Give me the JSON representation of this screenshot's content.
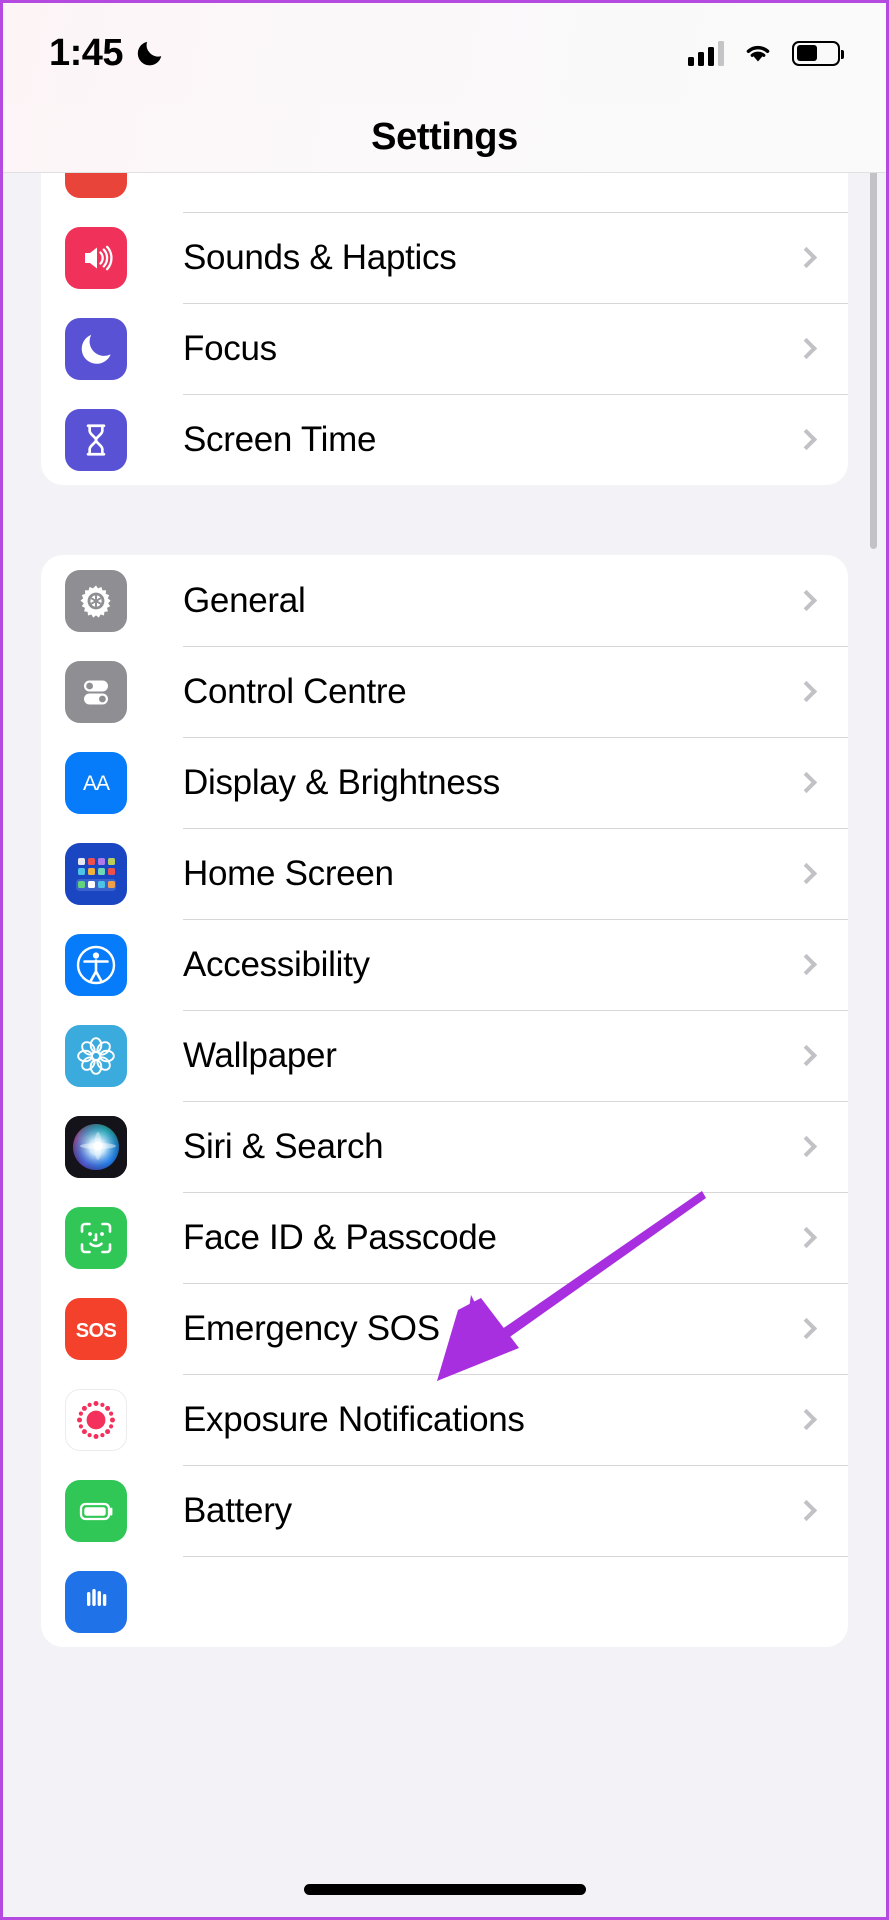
{
  "status_bar": {
    "time": "1:45",
    "dnd_icon": "crescent-moon-icon",
    "cellular_icon": "signal-bars-icon",
    "wifi_icon": "wifi-icon",
    "battery_icon": "battery-icon"
  },
  "nav": {
    "title": "Settings"
  },
  "groups": [
    {
      "id": "group-personal",
      "clipped": true,
      "rows": [
        {
          "label": "",
          "icon": "notifications-icon",
          "icon_color": "#e8443a",
          "partial": true
        },
        {
          "label": "Sounds & Haptics",
          "icon": "speaker-waves-icon",
          "icon_color": "#f0325a"
        },
        {
          "label": "Focus",
          "icon": "moon-icon",
          "icon_color": "#5a52d5"
        },
        {
          "label": "Screen Time",
          "icon": "hourglass-icon",
          "icon_color": "#5a52d5"
        }
      ]
    },
    {
      "id": "group-system",
      "clipped": false,
      "rows": [
        {
          "label": "General",
          "icon": "gear-icon",
          "icon_color": "#8e8e93"
        },
        {
          "label": "Control Centre",
          "icon": "toggles-icon",
          "icon_color": "#8e8e93"
        },
        {
          "label": "Display & Brightness",
          "icon": "aa-text-icon",
          "icon_color": "#067cfa"
        },
        {
          "label": "Home Screen",
          "icon": "app-grid-icon",
          "icon_color": "#1b46c2"
        },
        {
          "label": "Accessibility",
          "icon": "accessibility-person-icon",
          "icon_color": "#067cfa"
        },
        {
          "label": "Wallpaper",
          "icon": "flower-mandala-icon",
          "icon_color": "#3aabdc"
        },
        {
          "label": "Siri & Search",
          "icon": "siri-orb-icon",
          "icon_color": "#1c1c1e"
        },
        {
          "label": "Face ID & Passcode",
          "icon": "face-id-icon",
          "icon_color": "#30c757"
        },
        {
          "label": "Emergency SOS",
          "icon": "sos-icon",
          "icon_color": "#f4412c"
        },
        {
          "label": "Exposure Notifications",
          "icon": "exposure-dots-icon",
          "icon_color": "#ffffff"
        },
        {
          "label": "Battery",
          "icon": "battery-full-icon",
          "icon_color": "#30c757"
        },
        {
          "label": "",
          "icon": "privacy-hand-icon",
          "icon_color": "#1f72e8",
          "partial": true
        }
      ]
    }
  ],
  "annotation": {
    "arrow_color": "#a72fe0",
    "arrow_points_to": "Siri & Search"
  },
  "chrome": {
    "scrollbar": "vertical-scrollbar",
    "home_indicator": "home-indicator"
  }
}
